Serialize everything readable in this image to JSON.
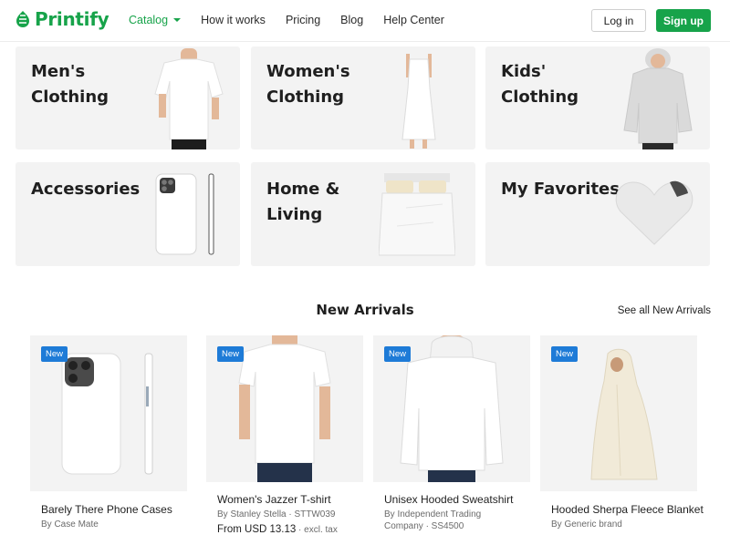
{
  "header": {
    "logo_text": "Printify",
    "nav": [
      {
        "label": "Catalog"
      },
      {
        "label": "How it works"
      },
      {
        "label": "Pricing"
      },
      {
        "label": "Blog"
      },
      {
        "label": "Help Center"
      }
    ],
    "login_label": "Log in",
    "signup_label": "Sign up"
  },
  "categories": [
    {
      "line1": "Men's",
      "line2": "Clothing"
    },
    {
      "line1": "Women's",
      "line2": "Clothing"
    },
    {
      "line1": "Kids'",
      "line2": "Clothing"
    },
    {
      "line1": "Accessories",
      "line2": ""
    },
    {
      "line1": "Home &",
      "line2": "Living"
    },
    {
      "line1": "My Favorites",
      "line2": ""
    }
  ],
  "new_arrivals": {
    "title": "New Arrivals",
    "see_all": "See all New Arrivals",
    "badge": "New",
    "products": [
      {
        "name": "Barely There Phone Cases",
        "by": "By Case Mate"
      },
      {
        "name": "Women's Jazzer T-shirt",
        "by": "By Stanley Stella · STTW039",
        "price": "From USD 13.13",
        "price_note": " · excl. tax"
      },
      {
        "name": "Unisex Hooded Sweatshirt",
        "by_line1": "By Independent Trading",
        "by_line2": "Company · SS4500"
      },
      {
        "name": "Hooded Sherpa Fleece Blanket",
        "by": "By Generic brand"
      }
    ]
  },
  "colors": {
    "brand": "#17a34a",
    "badge": "#1e7bd7",
    "card_bg": "#f3f3f3"
  }
}
